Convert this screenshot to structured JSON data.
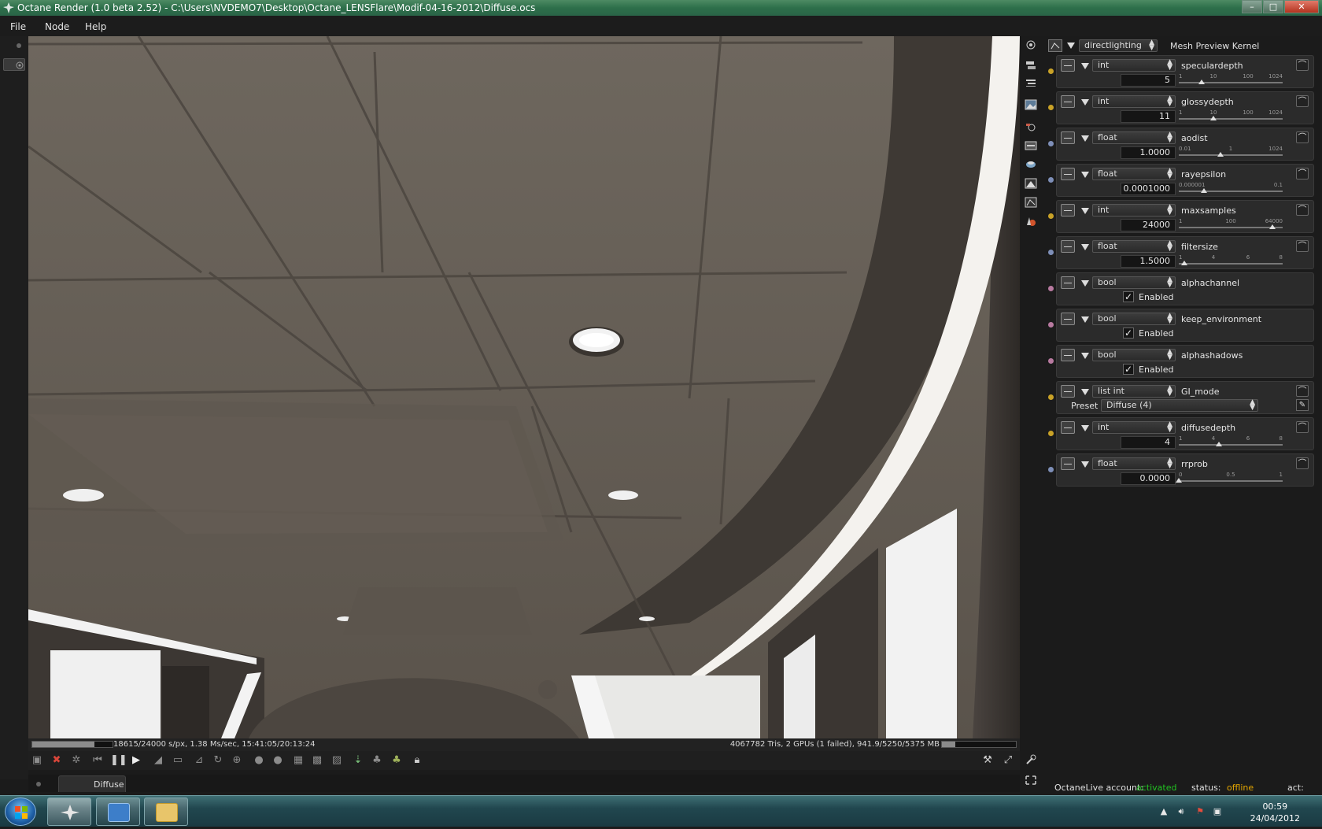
{
  "window": {
    "title": "Octane Render (1.0 beta 2.52) - C:\\Users\\NVDEMO7\\Desktop\\Octane_LENSFlare\\Modif-04-16-2012\\Diffuse.ocs",
    "minimize": "–",
    "maximize": "□",
    "close": "✕"
  },
  "menu": [
    "File",
    "Node",
    "Help"
  ],
  "status": {
    "left": "18615/24000 s/px, 1.38 Ms/sec, 15:41:05/20:13:24",
    "right": "4067782 Tris, 2 GPUs (1 failed), 941.9/5250/5375 MB",
    "progress": 0.7756,
    "memory_usage": 0.179
  },
  "tabs": [
    {
      "label": "Diffuse"
    }
  ],
  "kernel": {
    "type": "directlighting",
    "label": "Mesh Preview Kernel"
  },
  "params": [
    {
      "name": "speculardepth",
      "type": "int",
      "value": "5",
      "kind": "slider",
      "ticks": [
        "1",
        "10",
        "100",
        "1024"
      ],
      "thumb": 0.22,
      "color": "#c9a227"
    },
    {
      "name": "glossydepth",
      "type": "int",
      "value": "11",
      "kind": "slider",
      "ticks": [
        "1",
        "10",
        "100",
        "1024"
      ],
      "thumb": 0.33,
      "color": "#c9a227"
    },
    {
      "name": "aodist",
      "type": "float",
      "value": "1.0000",
      "kind": "slider",
      "ticks": [
        "0.01",
        "1",
        "1024"
      ],
      "thumb": 0.4,
      "color": "#7e8fb8"
    },
    {
      "name": "rayepsilon",
      "type": "float",
      "value": "0.0001000",
      "kind": "slider",
      "ticks": [
        "0.000001",
        "0.1"
      ],
      "thumb": 0.24,
      "color": "#7e8fb8"
    },
    {
      "name": "maxsamples",
      "type": "int",
      "value": "24000",
      "kind": "slider",
      "ticks": [
        "1",
        "100",
        "64000"
      ],
      "thumb": 0.9,
      "color": "#c9a227"
    },
    {
      "name": "filtersize",
      "type": "float",
      "value": "1.5000",
      "kind": "slider",
      "ticks": [
        "1",
        "4",
        "6",
        "8"
      ],
      "thumb": 0.05,
      "color": "#7e8fb8"
    },
    {
      "name": "alphachannel",
      "type": "bool",
      "kind": "check",
      "checked": true,
      "check_label": "Enabled",
      "color": "#b87aa0"
    },
    {
      "name": "keep_environment",
      "type": "bool",
      "kind": "check",
      "checked": true,
      "check_label": "Enabled",
      "color": "#b87aa0"
    },
    {
      "name": "alphashadows",
      "type": "bool",
      "kind": "check",
      "checked": true,
      "check_label": "Enabled",
      "color": "#b87aa0"
    },
    {
      "name": "GI_mode",
      "type": "list int",
      "kind": "preset",
      "preset_label": "Preset",
      "preset_value": "Diffuse (4)",
      "color": "#c9a227"
    },
    {
      "name": "diffusedepth",
      "type": "int",
      "value": "4",
      "kind": "slider",
      "ticks": [
        "1",
        "4",
        "6",
        "8"
      ],
      "thumb": 0.39,
      "color": "#c9a227"
    },
    {
      "name": "rrprob",
      "type": "float",
      "value": "0.0000",
      "kind": "slider",
      "ticks": [
        "0",
        "0.5",
        "1"
      ],
      "thumb": 0.0,
      "color": "#7e8fb8"
    }
  ],
  "live": {
    "account_label": "OctaneLive account:",
    "account_status": "activated",
    "status_label": "status:",
    "status_value": "offline",
    "act_label": "act:"
  },
  "taskbar": {
    "time": "00:59",
    "date": "24/04/2012"
  },
  "colors": {
    "accent_green": "#22c322",
    "offline": "#e3a500",
    "int_bullet": "#c9a227",
    "float_bullet": "#7e8fb8",
    "bool_bullet": "#b87aa0"
  }
}
